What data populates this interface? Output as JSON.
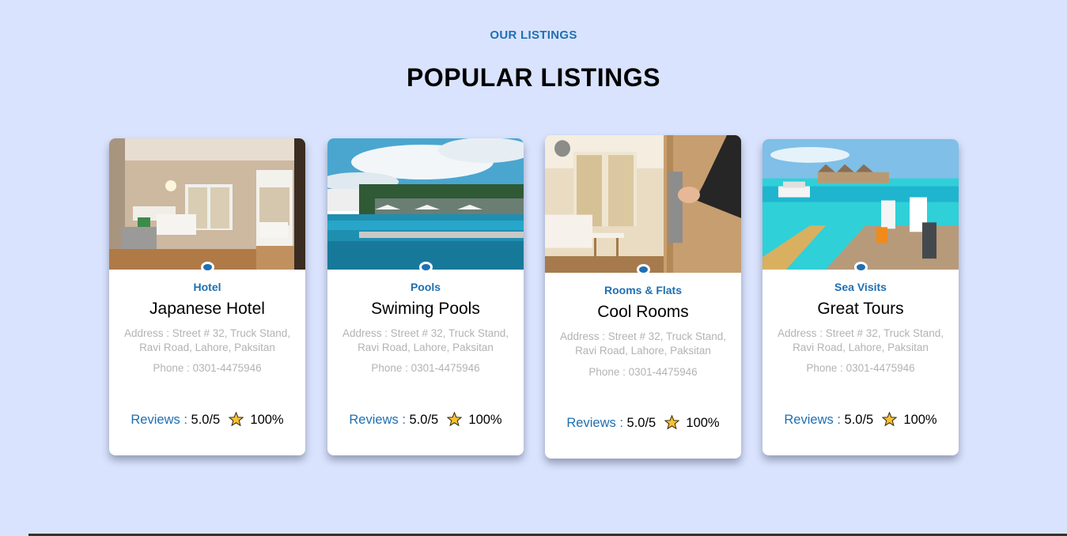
{
  "section": {
    "eyebrow": "OUR LISTINGS",
    "heading": "POPULAR LISTINGS"
  },
  "colors": {
    "background": "#d9e3fd",
    "accent": "#1f6fb2",
    "muted_text": "#b3b3b3"
  },
  "listings": [
    {
      "image": "hotel-room-photo",
      "category": "Hotel",
      "title": "Japanese Hotel",
      "address": "Address : Street # 32, Truck Stand, Ravi Road, Lahore, Paksitan",
      "phone": "Phone : 0301-4475946",
      "reviews_label": "Reviews :",
      "rating": "5.0/5",
      "rating_icon": "star-icon",
      "percent": "100%"
    },
    {
      "image": "swimming-pool-photo",
      "category": "Pools",
      "title": "Swiming Pools",
      "address": "Address : Street # 32, Truck Stand, Ravi Road, Lahore, Paksitan",
      "phone": "Phone : 0301-4475946",
      "reviews_label": "Reviews :",
      "rating": "5.0/5",
      "rating_icon": "star-icon",
      "percent": "100%"
    },
    {
      "image": "room-door-photo",
      "category": "Rooms & Flats",
      "title": "Cool Rooms",
      "address": "Address : Street # 32, Truck Stand, Ravi Road, Lahore, Paksitan",
      "phone": "Phone : 0301-4475946",
      "reviews_label": "Reviews :",
      "rating": "5.0/5",
      "rating_icon": "star-icon",
      "percent": "100%"
    },
    {
      "image": "sea-resort-photo",
      "category": "Sea Visits",
      "title": "Great Tours",
      "address": "Address : Street # 32, Truck Stand, Ravi Road, Lahore, Paksitan",
      "phone": "Phone : 0301-4475946",
      "reviews_label": "Reviews :",
      "rating": "5.0/5",
      "rating_icon": "star-icon",
      "percent": "100%"
    }
  ]
}
